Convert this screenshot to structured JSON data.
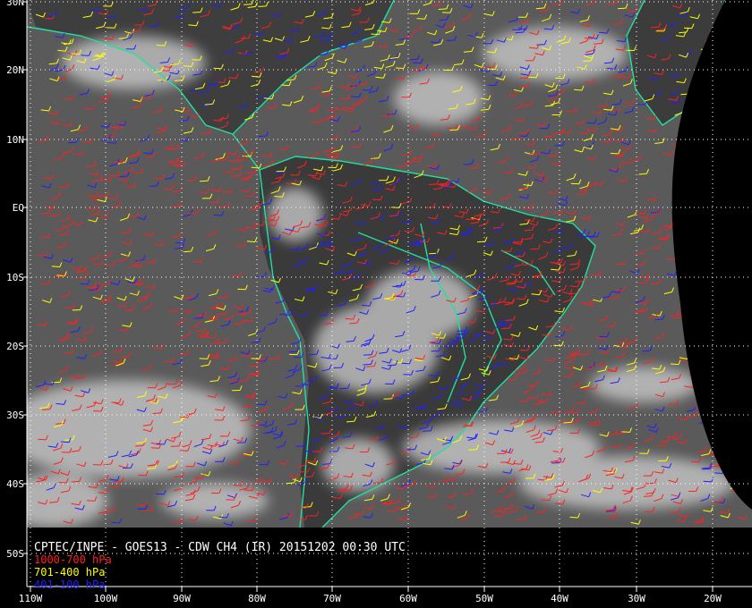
{
  "product": {
    "caption": "CPTEC/INPE - GOES13 - CDW CH4 (IR) 20151202 00:30 UTC"
  },
  "legend": [
    {
      "label": "1000-700 hPa",
      "color": "#ff2020"
    },
    {
      "label": "701-400 hPa",
      "color": "#ffff00"
    },
    {
      "label": "401-100 hPa",
      "color": "#2020ff"
    }
  ],
  "latitude_labels": [
    "30N",
    "20N",
    "10N",
    "EQ",
    "10S",
    "20S",
    "30S",
    "40S",
    "50S"
  ],
  "longitude_labels": [
    "110W",
    "100W",
    "90W",
    "80W",
    "70W",
    "60W",
    "50W",
    "40W",
    "30W",
    "20W"
  ],
  "colors": {
    "coastline": "#20e0a0",
    "grid": "#ffffff",
    "background": "#000000",
    "ocean": "#5a5a5a",
    "land": "#3c3c3c",
    "cloud": "#d8d8d8"
  }
}
